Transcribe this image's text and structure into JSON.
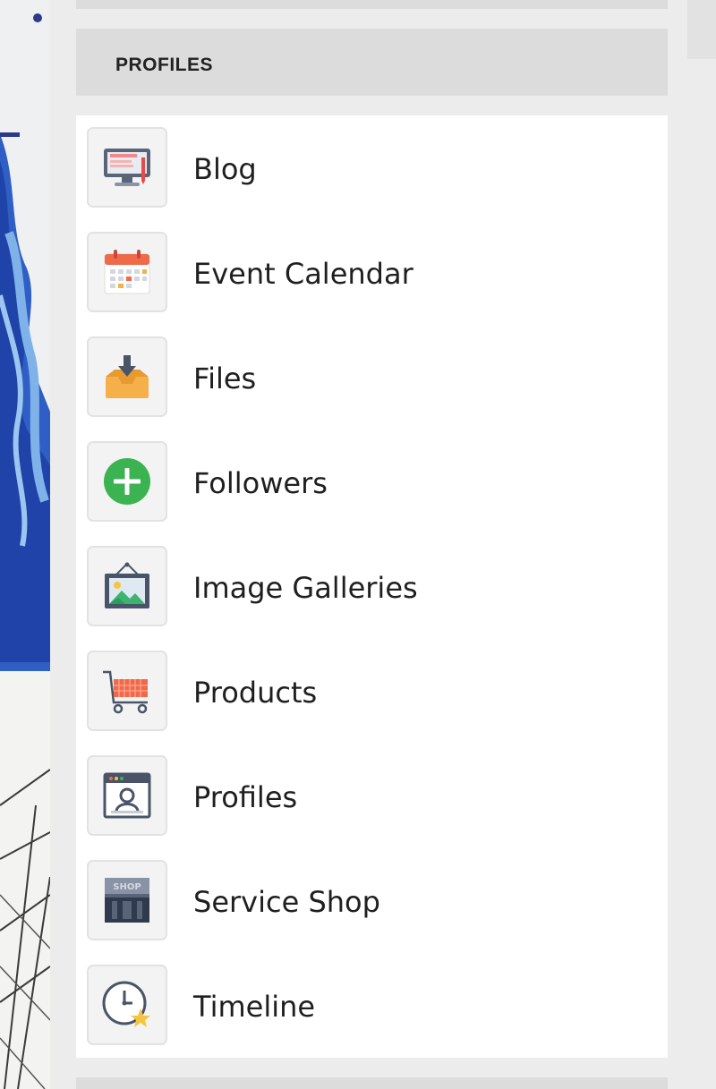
{
  "panel": {
    "title": "PROFILES",
    "items": [
      {
        "label": "Blog",
        "icon": "blog-monitor-icon"
      },
      {
        "label": "Event Calendar",
        "icon": "calendar-icon"
      },
      {
        "label": "Files",
        "icon": "file-download-tray-icon"
      },
      {
        "label": "Followers",
        "icon": "plus-circle-icon"
      },
      {
        "label": "Image Galleries",
        "icon": "picture-frame-icon"
      },
      {
        "label": "Products",
        "icon": "shopping-cart-icon"
      },
      {
        "label": "Profiles",
        "icon": "profile-window-icon"
      },
      {
        "label": "Service Shop",
        "icon": "shop-storefront-icon"
      },
      {
        "label": "Timeline",
        "icon": "clock-star-icon"
      }
    ]
  },
  "colors": {
    "panel_bg": "#dcdcdc",
    "list_bg": "#ffffff",
    "plus_green": "#3cb351",
    "calendar_red": "#f06a4a",
    "files_orange": "#f5b04a"
  }
}
